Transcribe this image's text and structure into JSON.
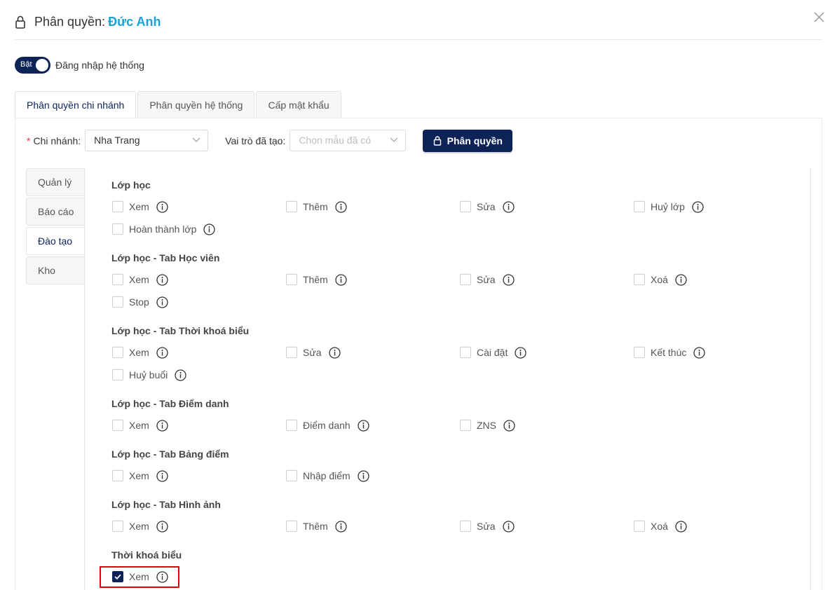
{
  "header": {
    "title_prefix": "Phân quyền:",
    "user_name": "Đức Anh"
  },
  "login_toggle": {
    "state_label": "Bật",
    "label": "Đăng nhập hệ thống",
    "enabled": true
  },
  "tabs": [
    {
      "label": "Phân quyền chi nhánh",
      "active": true
    },
    {
      "label": "Phân quyền hệ thống",
      "active": false
    },
    {
      "label": "Cấp mật khẩu",
      "active": false
    }
  ],
  "filters": {
    "branch_label": "Chi nhánh",
    "branch_value": "Nha Trang",
    "role_label": "Vai trò đã tạo",
    "role_placeholder": "Chọn mẫu đã có",
    "button_label": "Phân quyền"
  },
  "sidebar": [
    {
      "label": "Quản lý",
      "active": false
    },
    {
      "label": "Báo cáo",
      "active": false
    },
    {
      "label": "Đào tạo",
      "active": true
    },
    {
      "label": "Kho",
      "active": false
    }
  ],
  "sections": [
    {
      "title": "Lớp học",
      "perms": [
        {
          "label": "Xem",
          "checked": false
        },
        {
          "label": "Thêm",
          "checked": false
        },
        {
          "label": "Sửa",
          "checked": false
        },
        {
          "label": "Huỷ lớp",
          "checked": false
        },
        {
          "label": "Hoàn thành lớp",
          "checked": false
        }
      ]
    },
    {
      "title": "Lớp học - Tab Học viên",
      "perms": [
        {
          "label": "Xem",
          "checked": false
        },
        {
          "label": "Thêm",
          "checked": false
        },
        {
          "label": "Sửa",
          "checked": false
        },
        {
          "label": "Xoá",
          "checked": false
        },
        {
          "label": "Stop",
          "checked": false
        }
      ]
    },
    {
      "title": "Lớp học - Tab Thời khoá biểu",
      "perms": [
        {
          "label": "Xem",
          "checked": false
        },
        {
          "label": "Sửa",
          "checked": false
        },
        {
          "label": "Cài đặt",
          "checked": false
        },
        {
          "label": "Kết thúc",
          "checked": false
        },
        {
          "label": "Huỷ buổi",
          "checked": false
        }
      ]
    },
    {
      "title": "Lớp học - Tab Điểm danh",
      "perms": [
        {
          "label": "Xem",
          "checked": false
        },
        {
          "label": "Điểm danh",
          "checked": false
        },
        {
          "label": "ZNS",
          "checked": false
        }
      ]
    },
    {
      "title": "Lớp học - Tab Bảng điểm",
      "perms": [
        {
          "label": "Xem",
          "checked": false
        },
        {
          "label": "Nhập điểm",
          "checked": false
        }
      ]
    },
    {
      "title": "Lớp học - Tab Hình ảnh",
      "perms": [
        {
          "label": "Xem",
          "checked": false
        },
        {
          "label": "Thêm",
          "checked": false
        },
        {
          "label": "Sửa",
          "checked": false
        },
        {
          "label": "Xoá",
          "checked": false
        }
      ]
    },
    {
      "title": "Thời khoá biểu",
      "perms": [
        {
          "label": "Xem",
          "checked": true
        }
      ]
    }
  ],
  "icons": {
    "header": "lock-icon",
    "close": "close-icon",
    "info": "info-icon",
    "check": "check-icon",
    "chevron": "chevron-down-icon"
  },
  "colors": {
    "primary": "#0d2357",
    "name": "#1aa3d9",
    "highlight": "#e00000"
  }
}
